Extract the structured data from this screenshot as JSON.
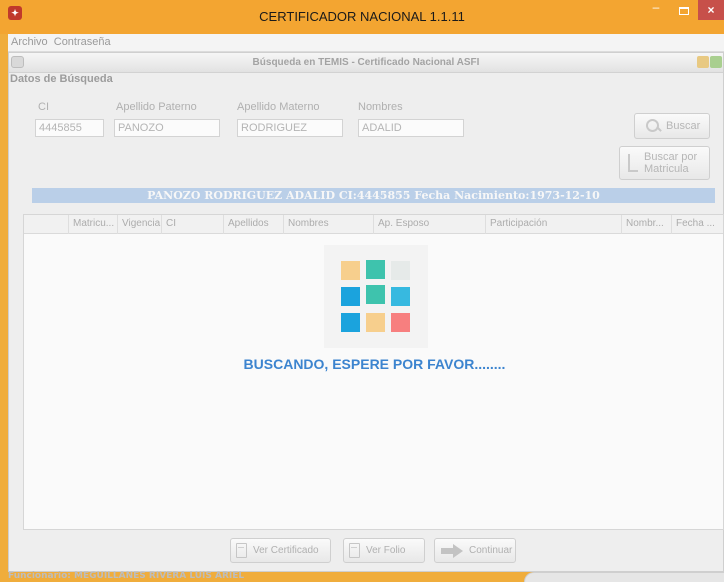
{
  "window": {
    "title": "CERTIFICADOR NACIONAL 1.1.11",
    "app_icon": "app-shield-icon",
    "controls": {
      "minimize": "–",
      "close": "×"
    }
  },
  "menu": [
    "Archivo",
    "Contraseña"
  ],
  "inner_window": {
    "title": "Búsqueda en TEMIS - Certificado Nacional ASFI"
  },
  "search": {
    "section_label": "Datos de Búsqueda",
    "fields": [
      {
        "label": "CI",
        "value": "4445855"
      },
      {
        "label": "Apellido Paterno",
        "value": "PANOZO"
      },
      {
        "label": "Apellido Materno",
        "value": "RODRIGUEZ"
      },
      {
        "label": "Nombres",
        "value": "ADALID"
      }
    ],
    "buscar_label": "Buscar",
    "buscar_matricula_line1": "Buscar por",
    "buscar_matricula_line2": "Matricula"
  },
  "result_bar": "PANOZO RODRIGUEZ ADALID CI:4445855 Fecha Nacimiento:1973-12-10",
  "table": {
    "columns": [
      "",
      "Matricu...",
      "Vigencia",
      "CI",
      "Apellidos",
      "Nombres",
      "Ap. Esposo",
      "Participación",
      "Nombr...",
      "Fecha ..."
    ],
    "rows": []
  },
  "loader": {
    "text": "BUSCANDO, ESPERE POR FAVOR........",
    "tile_colors": [
      "#f7cf8d",
      "#3ec3ad",
      "#e6eae9",
      "#1ba3dd",
      "#3ec3ad",
      "#37b9e0",
      "#1ba3dd",
      "#f7cf8d",
      "#f77f7f"
    ],
    "accent_color": "#3c84cf"
  },
  "actions": {
    "ver_certificado": "Ver Certificado",
    "ver_folio": "Ver Folio",
    "continuar": "Continuar"
  },
  "status": {
    "text": "Funcionario: MEGUILLANES RIVERA LUIS ARIEL"
  },
  "colors": {
    "title_bar": "#f3a531",
    "close_button": "#c7504a",
    "result_bar_bg": "#bacfe8"
  }
}
